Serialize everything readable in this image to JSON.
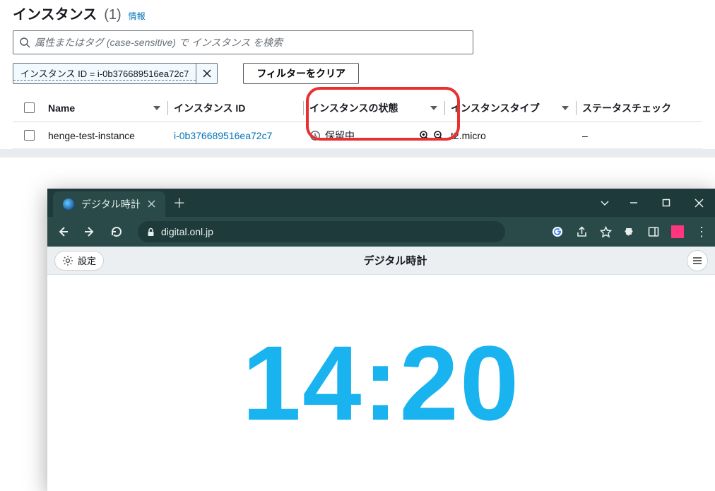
{
  "aws": {
    "title": "インスタンス",
    "count": "(1)",
    "infoLink": "情報",
    "search": {
      "placeholder": "属性またはタグ (case-sensitive) で インスタンス を検索"
    },
    "chip": {
      "text": "インスタンス ID = i-0b376689516ea72c7"
    },
    "clearFilters": "フィルターをクリア",
    "columns": {
      "name": "Name",
      "instanceId": "インスタンス ID",
      "state": "インスタンスの状態",
      "type": "インスタンスタイプ",
      "status": "ステータスチェック"
    },
    "row": {
      "name": "henge-test-instance",
      "instanceId": "i-0b376689516ea72c7",
      "state": "保留中",
      "type": "t2.micro",
      "status": "–"
    }
  },
  "browser": {
    "tabTitle": "デジタル時計",
    "url": "digital.onl.jp",
    "pageTitle": "デジタル時計",
    "settings": "設定",
    "time": "14:20"
  }
}
